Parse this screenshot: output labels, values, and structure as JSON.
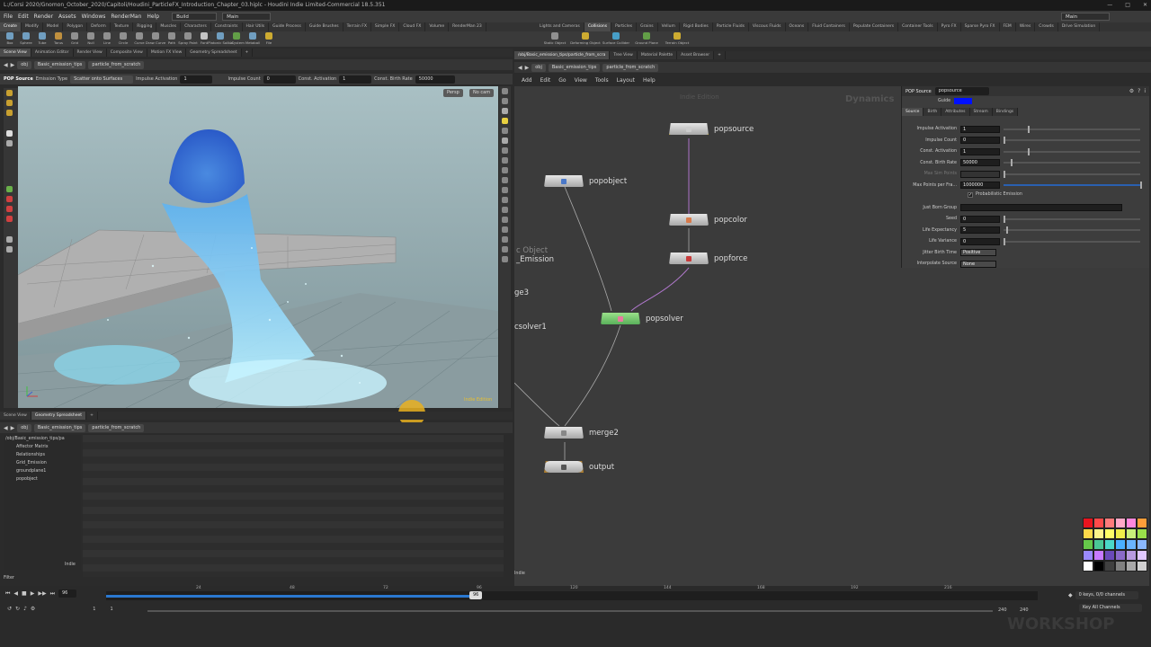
{
  "window": {
    "title": "L:/Corsi 2020/Gnomon_October_2020/Capitoli/Houdini_ParticleFX_Introduction_Chapter_03.hiplc - Houdini Indie Limited-Commercial 18.5.351"
  },
  "menu": {
    "items": [
      "File",
      "Edit",
      "Render",
      "Assets",
      "Windows",
      "RenderMan",
      "Help"
    ],
    "build_label": "Build",
    "desktop_label": "Main",
    "main_right": "Main"
  },
  "shelf_left": {
    "tabs": [
      "Create",
      "Modify",
      "Model",
      "Polygon",
      "Deform",
      "Texture",
      "Rigging",
      "Muscles",
      "Characters",
      "Constraints",
      "Hair Utils",
      "Guide Process",
      "Guide Brushes",
      "Terrain FX",
      "Simple FX",
      "Cloud FX",
      "Volume",
      "RenderMan 23"
    ],
    "tools": [
      "Box",
      "Sphere",
      "Tube",
      "Torus",
      "Grid",
      "Null",
      "Line",
      "Circle",
      "Curve",
      "Draw Curve",
      "Path",
      "Spray Paint",
      "Font",
      "Platonic Solids",
      "L-System",
      "Metaball",
      "File"
    ]
  },
  "shelf_right": {
    "tabs": [
      "Lights and Cameras",
      "Collisions",
      "Particles",
      "Grains",
      "Vellum",
      "Rigid Bodies",
      "Particle Fluids",
      "Viscous Fluids",
      "Oceans",
      "Fluid Containers",
      "Populate Containers",
      "Container Tools",
      "Pyro FX",
      "Sparse Pyro FX",
      "FEM",
      "Wires",
      "Crowds",
      "Drive Simulation"
    ],
    "tools": [
      "Static Object",
      "Deforming Object",
      "Surface Collider",
      "Ground Plane",
      "Terrain Object"
    ]
  },
  "viewer": {
    "tabs": [
      "Scene View",
      "Animation Editor",
      "Render View",
      "Composite View",
      "Motion FX View",
      "Geometry Spreadsheet"
    ],
    "path": [
      "obj",
      "Basic_emission_tips",
      "particle_from_scratch"
    ],
    "op_name": "POP Source",
    "emission_type_label": "Emission Type",
    "emission_type_value": "Scatter onto Surfaces",
    "impulse_activation_label": "Impulse Activation",
    "impulse_activation_value": "1",
    "impulse_count_label": "Impulse Count",
    "impulse_count_value": "0",
    "const_activation_label": "Const. Activation",
    "const_activation_value": "1",
    "const_birth_label": "Const. Birth Rate",
    "const_birth_value": "50000",
    "persp": "Persp",
    "cam": "No cam",
    "watermark": "Indie Edition"
  },
  "spreadsheet": {
    "tabs": [
      "Scene View",
      "Geometry Spreadsheet"
    ],
    "path": [
      "obj",
      "Basic_emission_tips",
      "particle_from_scratch"
    ],
    "tree": [
      "/obj/Basic_emission_tips/pa",
      "Affector Matrix",
      "Relationships",
      "Grid_Emission",
      "groundplane1",
      "popobject"
    ],
    "corner_label": "Indie",
    "filter_label": "Filter"
  },
  "network": {
    "tabs": [
      "/obj/Basic_emission_tips/particle_from_scra",
      "Tree View",
      "Material Palette",
      "Asset Browser"
    ],
    "path": [
      "obj",
      "Basic_emission_tips",
      "particle_from_scratch"
    ],
    "menu": [
      "Add",
      "Edit",
      "Go",
      "View",
      "Tools",
      "Layout",
      "Help"
    ],
    "watermark": "Indie Edition",
    "context": "Dynamics",
    "nodes": [
      "popsource",
      "popobject",
      "popcolor",
      "popforce",
      "popsolver",
      "merge2",
      "output"
    ],
    "partial_labels": [
      "c Object",
      "_Emission",
      "ge3",
      "csolver1"
    ],
    "indie_corner": "Indie"
  },
  "params": {
    "op_type": "POP Source",
    "op_name": "popsource",
    "tabs": [
      "Source",
      "Birth",
      "Attributes",
      "Stream",
      "Bindings"
    ],
    "rows": [
      {
        "label": "Impulse Activation",
        "value": "1",
        "level": 0.18
      },
      {
        "label": "Impulse Count",
        "value": "0",
        "level": 0
      },
      {
        "label": "Const. Activation",
        "value": "1",
        "level": 0.18
      },
      {
        "label": "Const. Birth Rate",
        "value": "50000",
        "level": 0.05
      },
      {
        "label": "Max Sim Points",
        "value": "",
        "level": 0
      },
      {
        "label": "Max Points per Fra...",
        "value": "1000000",
        "level": 1.0
      },
      {
        "label": "",
        "value": "",
        "level": 0
      },
      {
        "label": "Just Born Group",
        "value": "",
        "level": 0
      },
      {
        "label": "Seed",
        "value": "0",
        "level": 0
      },
      {
        "label": "Life Expectancy",
        "value": "5",
        "level": 0.02
      },
      {
        "label": "Life Variance",
        "value": "0",
        "level": 0
      },
      {
        "label": "Jitter Birth Time",
        "value": "Positive",
        "level": 0
      },
      {
        "label": "Interpolate Source",
        "value": "None",
        "level": 0
      }
    ],
    "prob_emission": "Probabilistic Emission",
    "color_label": "Guide"
  },
  "timeline": {
    "current_frame": "96",
    "ticks": [
      "24",
      "48",
      "72",
      "96",
      "120",
      "144",
      "168",
      "192",
      "216"
    ],
    "start": "1",
    "start2": "1",
    "end": "240",
    "end2": "240",
    "keys_label": "0 keys, 0/0 channels",
    "key_all": "Key All Channels",
    "watermark": "WORKSHOP"
  },
  "palette": {
    "colors": [
      "#e8141e",
      "#ff4a4a",
      "#ff7b7b",
      "#ffa9c8",
      "#ff88dd",
      "#ff9e3a",
      "#ffd94a",
      "#fff38a",
      "#ffff66",
      "#f0f04a",
      "#c8f07a",
      "#9ae04a",
      "#66c84a",
      "#4ac896",
      "#4ad8c8",
      "#4ab0ff",
      "#6ab4ff",
      "#8ab8ff",
      "#9a8aff",
      "#c87aff",
      "#6a4ab8",
      "#8a6ac8",
      "#b89ae0",
      "#e0c8ff",
      "#ffffff",
      "#000000",
      "#404040",
      "#808080",
      "#a8a8a8",
      "#d0d0d0"
    ]
  }
}
